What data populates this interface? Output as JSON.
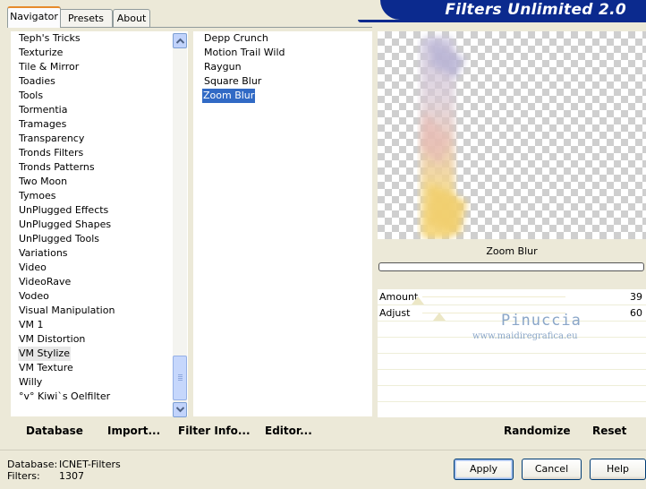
{
  "tabs": [
    {
      "label": "Navigator",
      "active": true
    },
    {
      "label": "Presets",
      "active": false
    },
    {
      "label": "About",
      "active": false
    }
  ],
  "banner_title": "Filters Unlimited 2.0",
  "categories": [
    "Teph's Tricks",
    "Texturize",
    "Tile & Mirror",
    "Toadies",
    "Tools",
    "Tormentia",
    "Tramages",
    "Transparency",
    "Tronds Filters",
    "Tronds Patterns",
    "Two Moon",
    "Tymoes",
    "UnPlugged Effects",
    "UnPlugged Shapes",
    "UnPlugged Tools",
    "Variations",
    "Video",
    "VideoRave",
    "Vodeo",
    "Visual Manipulation",
    "VM 1",
    "VM Distortion",
    "VM Stylize",
    "VM Texture",
    "Willy",
    "°v° Kiwi`s Oelfilter"
  ],
  "selected_category": "VM Stylize",
  "filters": [
    "Depp Crunch",
    "Motion Trail Wild",
    "Raygun",
    "Square Blur",
    "Zoom Blur"
  ],
  "selected_filter": "Zoom Blur",
  "left_buttons": {
    "database": "Database",
    "import": "Import...",
    "filter_info": "Filter Info...",
    "editor": "Editor..."
  },
  "preview": {
    "filter_name": "Zoom Blur",
    "progress_fraction": 0
  },
  "sliders": [
    {
      "label": "Amount",
      "value": "39",
      "level": 0.15
    },
    {
      "label": "Adjust",
      "value": "60",
      "level": 0.23
    }
  ],
  "watermark": {
    "name": "Pinuccia",
    "site": "www.maidiregrafica.eu"
  },
  "right_buttons": {
    "randomize": "Randomize",
    "reset": "Reset"
  },
  "status": {
    "database_label": "Database:",
    "database_value": "ICNET-Filters",
    "filters_label": "Filters:",
    "filters_value": "1307"
  },
  "dialog_buttons": {
    "apply": "Apply",
    "cancel": "Cancel",
    "help": "Help"
  },
  "colors": {
    "banner": "#0b2a8e",
    "selection": "#316ac5",
    "face": "#ece9d8"
  }
}
